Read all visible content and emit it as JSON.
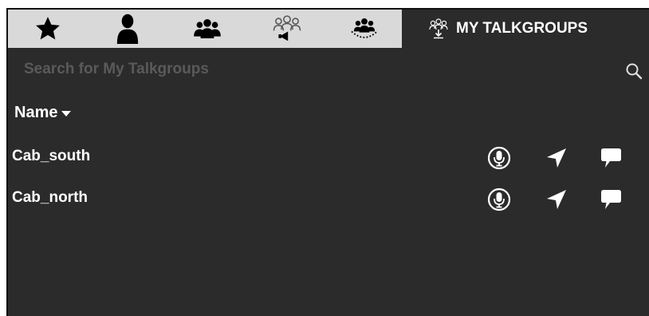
{
  "tabs": [
    {
      "icon": "star-icon"
    },
    {
      "icon": "user-icon"
    },
    {
      "icon": "group-icon"
    },
    {
      "icon": "broadcast-group-icon"
    },
    {
      "icon": "scanned-group-icon"
    },
    {
      "icon": "my-talkgroups-icon",
      "label": "MY TALKGROUPS",
      "active": true
    }
  ],
  "search": {
    "placeholder": "Search for My Talkgroups",
    "value": ""
  },
  "list": {
    "column_header": "Name",
    "sort": "descending",
    "rows": [
      {
        "name": "Cab_south",
        "actions": [
          "microphone-icon",
          "location-arrow-icon",
          "chat-bubble-icon"
        ]
      },
      {
        "name": "Cab_north",
        "actions": [
          "microphone-icon",
          "location-arrow-icon",
          "chat-bubble-icon"
        ]
      }
    ]
  },
  "colors": {
    "background": "#2b2b2b",
    "tabbar": "#d9d9d9",
    "text": "#ffffff",
    "placeholder": "#5a5a5a"
  }
}
